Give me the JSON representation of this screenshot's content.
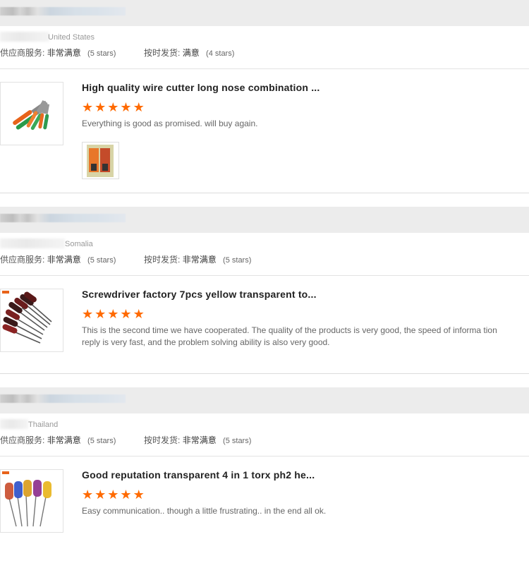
{
  "labels": {
    "supplier_service": "供应商服务:",
    "on_time_shipment": "按时发货:"
  },
  "reviews": [
    {
      "country": "United States",
      "supplier_service_rating": "非常满意",
      "supplier_service_stars": "(5 stars)",
      "on_time_rating": "满意",
      "on_time_stars": "(4 stars)",
      "product_title": "High quality wire cutter long nose combination ...",
      "stars": 5,
      "comment": "Everything is good as promised. will buy again."
    },
    {
      "country": "Somalia",
      "supplier_service_rating": "非常满意",
      "supplier_service_stars": "(5 stars)",
      "on_time_rating": "非常满意",
      "on_time_stars": "(5 stars)",
      "product_title": "Screwdriver factory 7pcs yellow transparent to...",
      "stars": 5,
      "comment": "This is the second time we have cooperated. The quality of the products is very good, the speed of informa tion reply is very fast, and the problem solving ability is also very good."
    },
    {
      "country": "Thailand",
      "supplier_service_rating": "非常满意",
      "supplier_service_stars": "(5 stars)",
      "on_time_rating": "非常满意",
      "on_time_stars": "(5 stars)",
      "product_title": "Good reputation transparent 4 in 1 torx ph2 he...",
      "stars": 5,
      "comment": "Easy communication.. though a little frustrating.. in the end all ok."
    }
  ],
  "colors": {
    "star": "#ff6a00",
    "header_bg": "#ececec"
  }
}
